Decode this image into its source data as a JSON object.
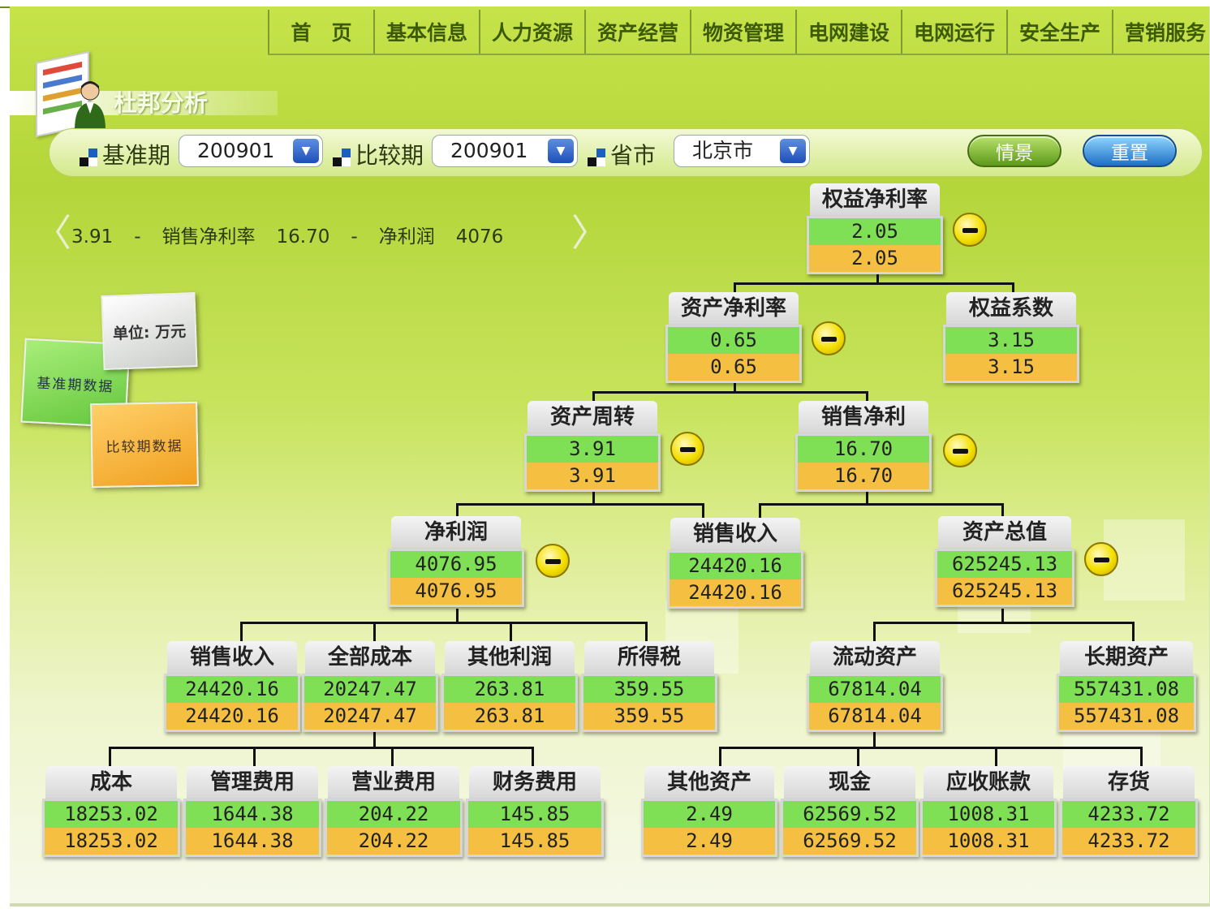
{
  "nav": [
    "首　页",
    "基本信息",
    "人力资源",
    "资产经营",
    "物资管理",
    "电网建设",
    "电网运行",
    "安全生产",
    "营销服务"
  ],
  "page_title": "杜邦分析",
  "filters": {
    "base_label": "基准期",
    "base_value": "200901",
    "compare_label": "比较期",
    "compare_value": "200901",
    "province_label": "省市",
    "province_value": "北京市"
  },
  "buttons": {
    "scene": "情景",
    "reset": "重置"
  },
  "ticker": [
    "3.91",
    "-",
    "销售净利率",
    "16.70",
    "-",
    "净利润",
    "4076"
  ],
  "legend": {
    "unit": "单位: 万元",
    "base": "基准期数据",
    "compare": "比较期数据"
  },
  "colors": {
    "base_value_bg": "#7fe055",
    "compare_value_bg": "#f5c042"
  },
  "tree": {
    "roe": {
      "label": "权益净利率",
      "base": "2.05",
      "compare": "2.05"
    },
    "roa": {
      "label": "资产净利率",
      "base": "0.65",
      "compare": "0.65"
    },
    "equity_multiplier": {
      "label": "权益系数",
      "base": "3.15",
      "compare": "3.15"
    },
    "asset_turnover": {
      "label": "资产周转",
      "base": "3.91",
      "compare": "3.91"
    },
    "net_margin": {
      "label": "销售净利",
      "base": "16.70",
      "compare": "16.70"
    },
    "net_profit": {
      "label": "净利润",
      "base": "4076.95",
      "compare": "4076.95"
    },
    "revenue": {
      "label": "销售收入",
      "base": "24420.16",
      "compare": "24420.16"
    },
    "total_assets": {
      "label": "资产总值",
      "base": "625245.13",
      "compare": "625245.13"
    },
    "sales_income": {
      "label": "销售收入",
      "base": "24420.16",
      "compare": "24420.16"
    },
    "total_cost": {
      "label": "全部成本",
      "base": "20247.47",
      "compare": "20247.47"
    },
    "other_profit": {
      "label": "其他利润",
      "base": "263.81",
      "compare": "263.81"
    },
    "income_tax": {
      "label": "所得税",
      "base": "359.55",
      "compare": "359.55"
    },
    "current_assets": {
      "label": "流动资产",
      "base": "67814.04",
      "compare": "67814.04"
    },
    "long_term_assets": {
      "label": "长期资产",
      "base": "557431.08",
      "compare": "557431.08"
    },
    "cost": {
      "label": "成本",
      "base": "18253.02",
      "compare": "18253.02"
    },
    "admin_expense": {
      "label": "管理费用",
      "base": "1644.38",
      "compare": "1644.38"
    },
    "selling_expense": {
      "label": "营业费用",
      "base": "204.22",
      "compare": "204.22"
    },
    "finance_expense": {
      "label": "财务费用",
      "base": "145.85",
      "compare": "145.85"
    },
    "other_assets": {
      "label": "其他资产",
      "base": "2.49",
      "compare": "2.49"
    },
    "cash": {
      "label": "现金",
      "base": "62569.52",
      "compare": "62569.52"
    },
    "receivables": {
      "label": "应收账款",
      "base": "1008.31",
      "compare": "1008.31"
    },
    "inventory": {
      "label": "存货",
      "base": "4233.72",
      "compare": "4233.72"
    }
  }
}
